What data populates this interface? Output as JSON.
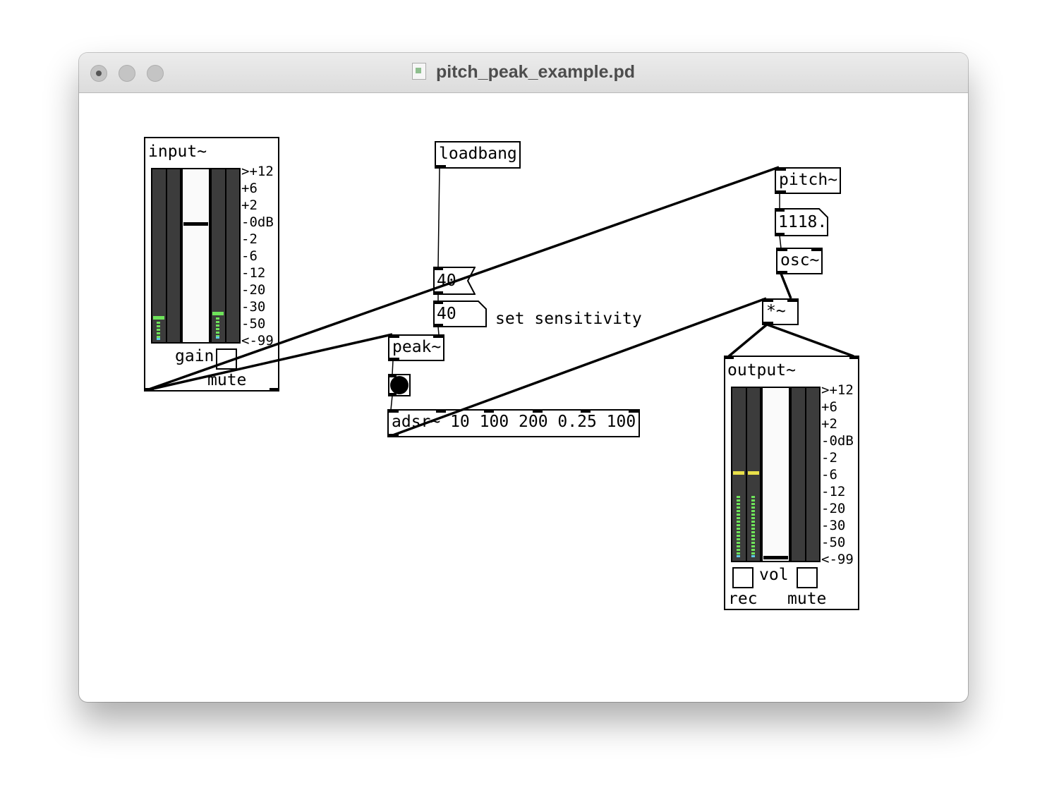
{
  "window": {
    "title": "pitch_peak_example.pd"
  },
  "objects": {
    "loadbang": "loadbang",
    "pitch": "pitch~",
    "pitch_number": "1118.",
    "osc": "osc~",
    "multiply": "*~",
    "msg_sensitivity": "40",
    "number_sensitivity": "40",
    "sensitivity_comment": "set sensitivity",
    "peak": "peak~",
    "adsr": "adsr~ 10 100 200 0.25 100"
  },
  "input_panel": {
    "title": "input~",
    "scale_labels": [
      ">+12",
      "+6",
      "+2",
      "-0dB",
      "-2",
      "-6",
      "-12",
      "-20",
      "-30",
      "-50",
      "<-99"
    ],
    "gain_label": "gain",
    "mute_label": "mute",
    "mute_on": false
  },
  "output_panel": {
    "title": "output~",
    "scale_labels": [
      ">+12",
      "+6",
      "+2",
      "-0dB",
      "-2",
      "-6",
      "-12",
      "-20",
      "-30",
      "-50",
      "<-99"
    ],
    "vol_label": "vol",
    "rec_label": "rec",
    "mute_label": "mute",
    "rec_on": false,
    "mute_on": false
  },
  "colors": {
    "meter_bg": "#3c3c3c",
    "meter_green": "#6ee35a",
    "meter_yellow": "#e9e04a",
    "meter_cyan": "#5fc9e6"
  }
}
